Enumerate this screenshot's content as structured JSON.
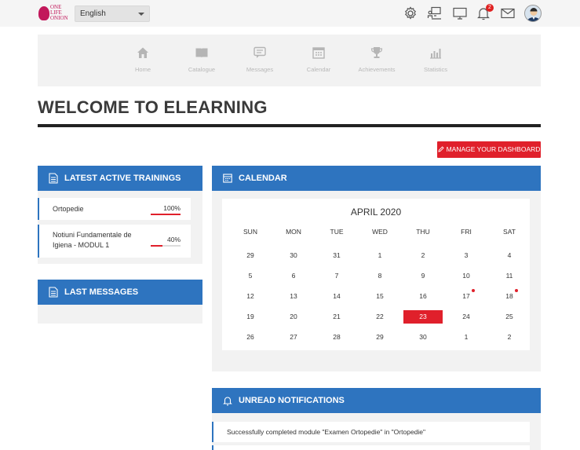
{
  "header": {
    "logo_lines": [
      "ONE",
      "LIFE",
      "ONION"
    ],
    "language": "English",
    "notification_count": "2"
  },
  "nav": [
    {
      "label": "Home",
      "icon": "home-icon"
    },
    {
      "label": "Catalogue",
      "icon": "book-icon"
    },
    {
      "label": "Messages",
      "icon": "message-icon"
    },
    {
      "label": "Calendar",
      "icon": "calendar-icon"
    },
    {
      "label": "Achievements",
      "icon": "trophy-icon"
    },
    {
      "label": "Statistics",
      "icon": "statistics-icon"
    }
  ],
  "page": {
    "title": "WELCOME TO ELEARNING",
    "manage_button": "MANAGE YOUR DASHBOARD"
  },
  "trainings": {
    "title": "LATEST ACTIVE TRAININGS",
    "items": [
      {
        "name": "Ortopedie",
        "percent": "100%",
        "progress": 1.0
      },
      {
        "name": "Notiuni Fundamentale de Igiena - MODUL 1",
        "percent": "40%",
        "progress": 0.4
      }
    ]
  },
  "messages": {
    "title": "LAST MESSAGES"
  },
  "calendar": {
    "title": "CALENDAR",
    "month": "APRIL 2020",
    "weekdays": [
      "SUN",
      "MON",
      "TUE",
      "WED",
      "THU",
      "FRI",
      "SAT"
    ],
    "weeks": [
      [
        "29",
        "30",
        "31",
        "1",
        "2",
        "3",
        "4"
      ],
      [
        "5",
        "6",
        "7",
        "8",
        "9",
        "10",
        "11"
      ],
      [
        "12",
        "13",
        "14",
        "15",
        "16",
        "17",
        "18"
      ],
      [
        "19",
        "20",
        "21",
        "22",
        "23",
        "24",
        "25"
      ],
      [
        "26",
        "27",
        "28",
        "29",
        "30",
        "1",
        "2"
      ]
    ],
    "today": "23",
    "event_days": [
      "17",
      "18"
    ]
  },
  "notifications": {
    "title": "UNREAD NOTIFICATIONS",
    "items": [
      "Successfully completed module \"Examen Ortopedie\" in \"Ortopedie\""
    ]
  },
  "colors": {
    "accent_blue": "#2e74bf",
    "accent_red": "#e0202b"
  }
}
